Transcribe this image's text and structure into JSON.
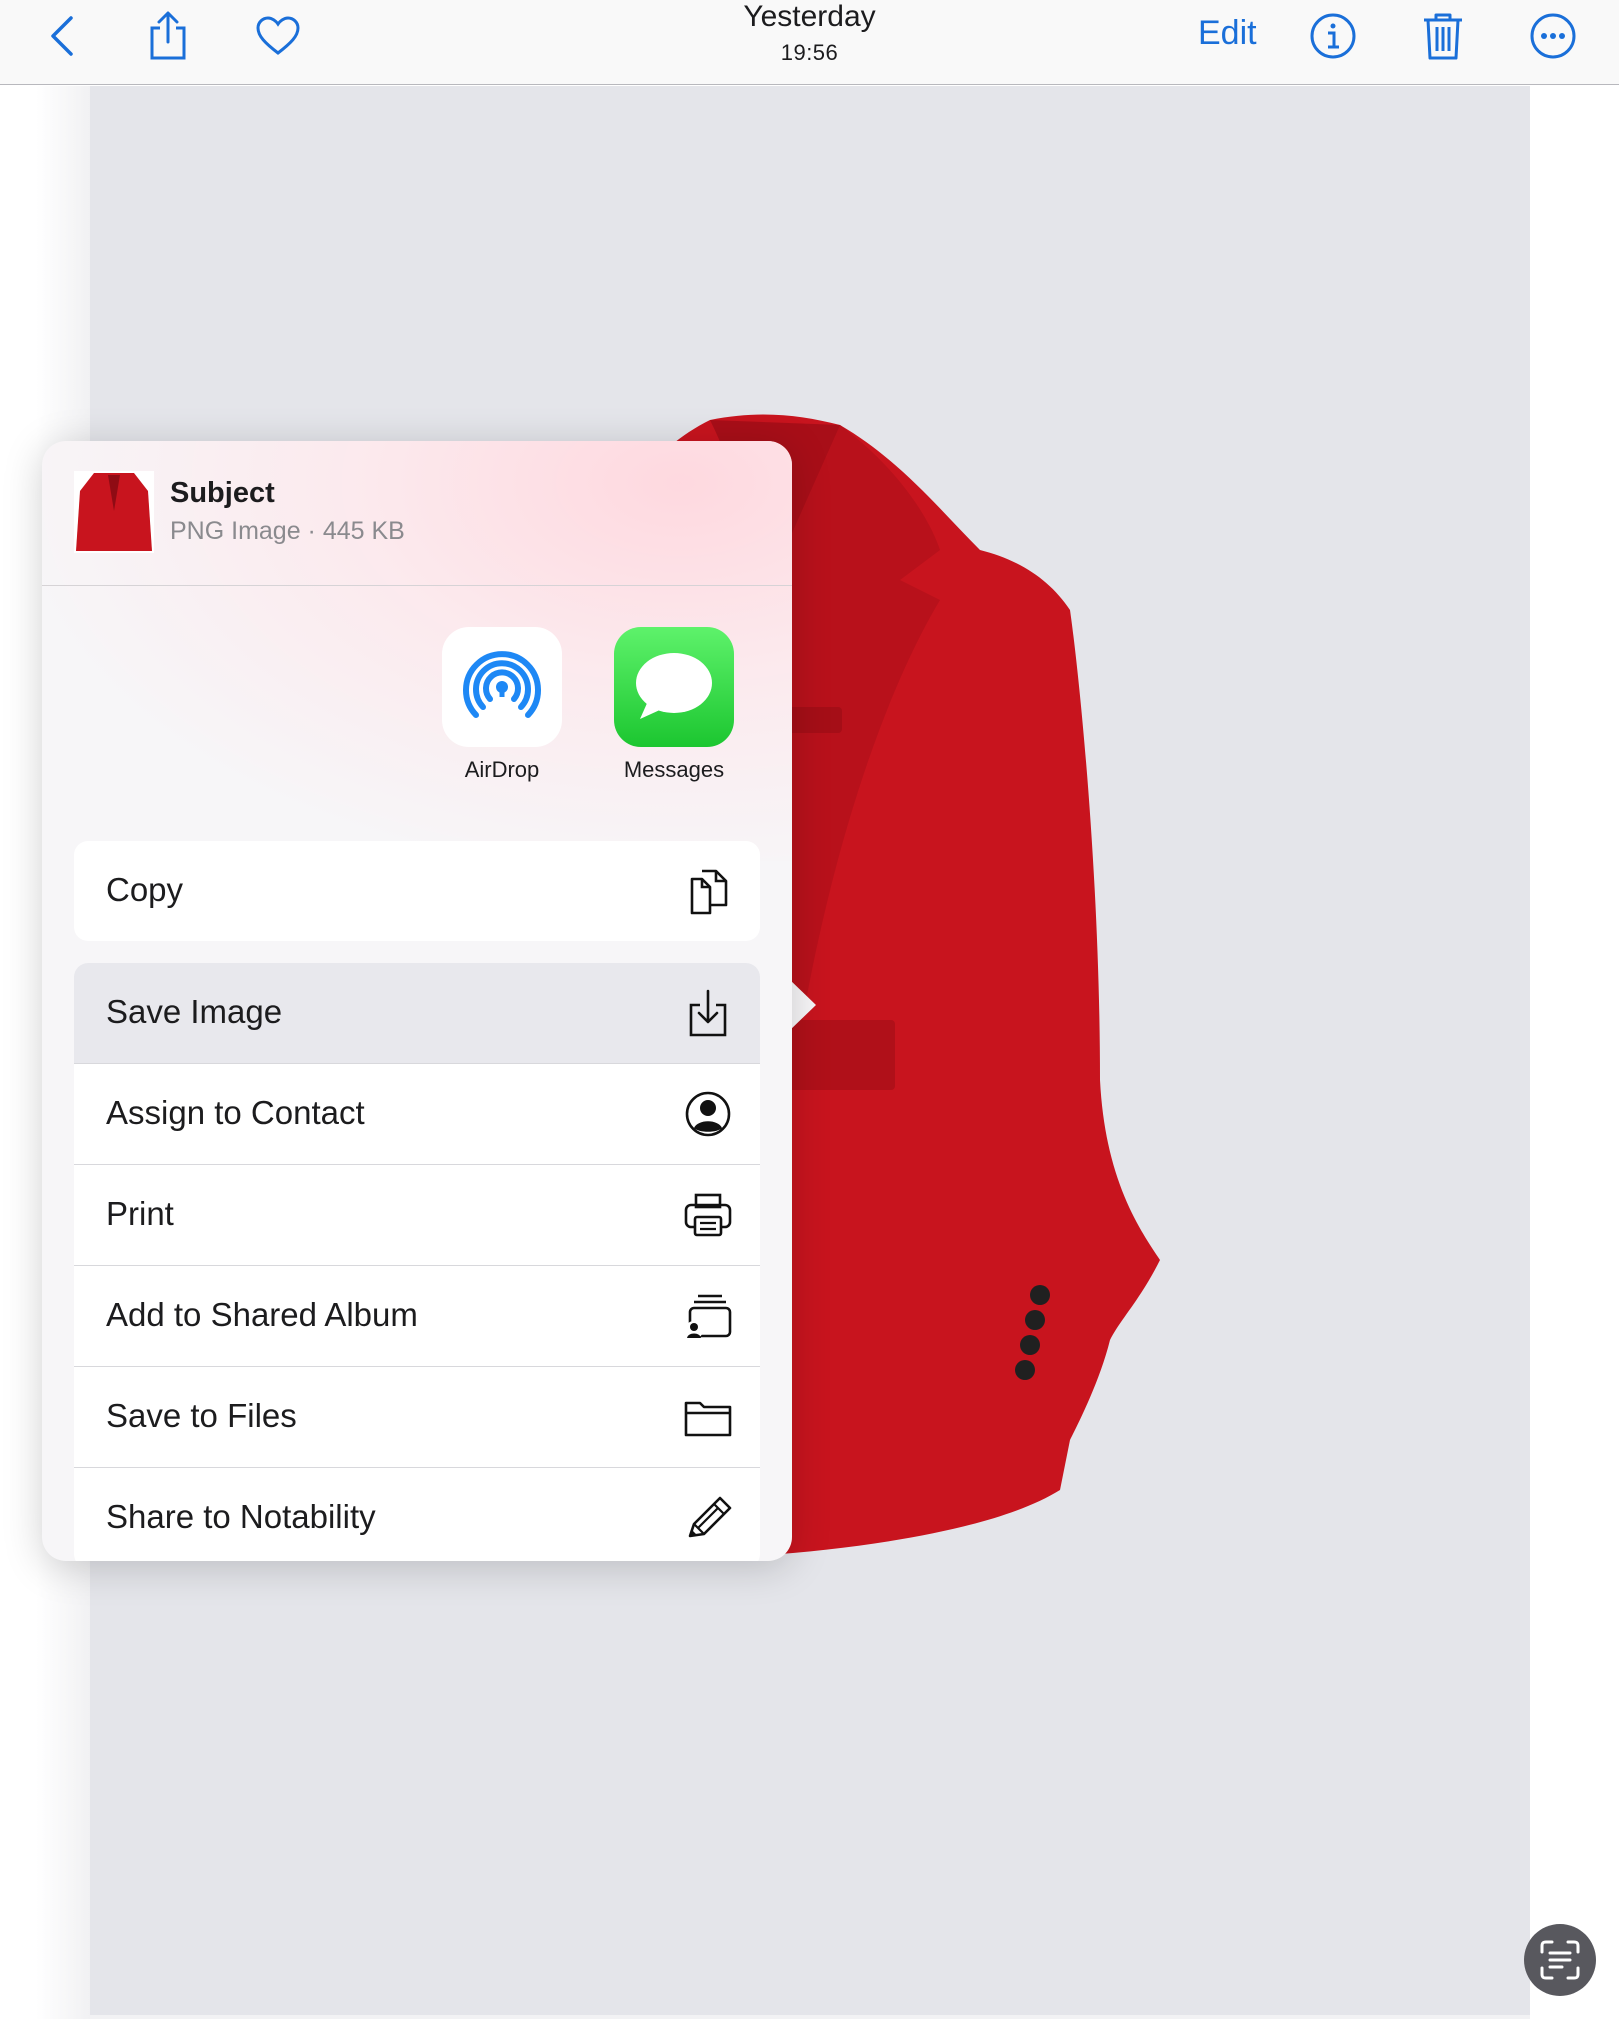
{
  "toolbar": {
    "title": "Yesterday",
    "subtitle": "19:56",
    "edit_label": "Edit",
    "icons": [
      "chevron-left-icon",
      "share-icon",
      "heart-icon",
      "info-icon",
      "trash-icon",
      "ellipsis-icon"
    ],
    "accent_color": "#1a6fd9"
  },
  "share_sheet": {
    "item_title": "Subject",
    "item_subtitle": "PNG Image · 445 KB",
    "apps": [
      {
        "label": "AirDrop",
        "icon": "airdrop-icon"
      },
      {
        "label": "Messages",
        "icon": "messages-icon"
      }
    ],
    "actions": [
      {
        "label": "Copy",
        "icon": "copy-icon"
      },
      {
        "label": "Save Image",
        "icon": "save-image-icon",
        "selected": true
      },
      {
        "label": "Assign to Contact",
        "icon": "contact-icon"
      },
      {
        "label": "Print",
        "icon": "printer-icon"
      },
      {
        "label": "Add to Shared Album",
        "icon": "shared-album-icon"
      },
      {
        "label": "Save to Files",
        "icon": "folder-icon"
      },
      {
        "label": "Share to Notability",
        "icon": "pencil-icon"
      }
    ]
  },
  "photo": {
    "subject": "red blazer",
    "background_color": "#e4e5ea"
  },
  "live_text_button": {
    "icon": "live-text-icon"
  }
}
